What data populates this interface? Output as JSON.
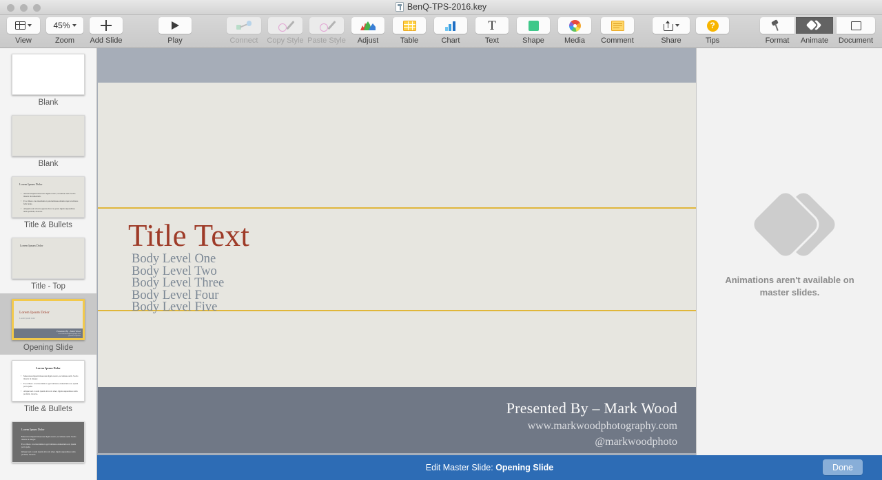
{
  "window": {
    "title": "BenQ-TPS-2016.key",
    "file_icon": "keynote-document-icon"
  },
  "toolbar": {
    "left_group": [
      {
        "label": "View",
        "icon": "layout-panels-icon",
        "has_chevron": true,
        "enabled": true
      },
      {
        "label": "Zoom",
        "icon": "zoom-value",
        "value": "45%",
        "has_chevron": true,
        "enabled": true
      },
      {
        "label": "Add Slide",
        "icon": "plus-icon",
        "has_chevron": false,
        "enabled": true
      },
      {
        "label": "Play",
        "icon": "play-triangle-icon",
        "has_chevron": false,
        "enabled": true
      }
    ],
    "center_group": [
      {
        "label": "Connect",
        "icon": "connect-icon",
        "enabled": false
      },
      {
        "label": "Copy Style",
        "icon": "eyedropper-icon",
        "enabled": false
      },
      {
        "label": "Paste Style",
        "icon": "eyedropper-icon",
        "enabled": false
      },
      {
        "label": "Adjust",
        "icon": "histogram-icon",
        "enabled": true
      },
      {
        "label": "Table",
        "icon": "table-grid-icon",
        "enabled": true
      },
      {
        "label": "Chart",
        "icon": "bar-chart-icon",
        "enabled": true
      },
      {
        "label": "Text",
        "icon": "text-t-icon",
        "enabled": true
      },
      {
        "label": "Shape",
        "icon": "square-shape-icon",
        "enabled": true
      },
      {
        "label": "Media",
        "icon": "photos-color-wheel-icon",
        "enabled": true
      },
      {
        "label": "Comment",
        "icon": "sticky-note-icon",
        "enabled": true
      }
    ],
    "share_group": [
      {
        "label": "Share",
        "icon": "share-upload-icon",
        "has_chevron": true,
        "enabled": true
      },
      {
        "label": "Tips",
        "icon": "question-mark-icon",
        "enabled": true
      }
    ],
    "right_group": [
      {
        "label": "Format",
        "icon": "paintbrush-icon",
        "selected": false
      },
      {
        "label": "Animate",
        "icon": "animate-diamonds-icon",
        "selected": true
      },
      {
        "label": "Document",
        "icon": "document-rectangle-icon",
        "selected": false
      }
    ]
  },
  "sidebar": {
    "slides": [
      {
        "name": "Blank",
        "kind": "blank-white",
        "selected": false
      },
      {
        "name": "Blank",
        "kind": "blank-cream",
        "selected": false
      },
      {
        "name": "Title & Bullets",
        "kind": "title-bullets-cream",
        "selected": false,
        "title": "Lorem Ipsum Dolor",
        "bullets": [
          "Aenean aliquam maecenas ligula nostra, accumsan sem. Sociis mauris incrementum.",
          "Et ac libero cras interdum at quis habitasse ullamcorper ut ultrices felis ludus.",
          "Aliquam sem viverra egestas dolor ut, justo ligula suspendisse nulla pretium, rhoncus."
        ]
      },
      {
        "name": "Title - Top",
        "kind": "title-top-cream",
        "selected": false,
        "title": "Lorem Ipsum Dolor"
      },
      {
        "name": "Opening Slide",
        "kind": "opening-slide",
        "selected": true,
        "title": "Lorem Ipsum Dolor",
        "subtitle": "Lorem ipsum dolor",
        "footer_main": "Presented By - Mark Wood",
        "footer_sub1": "www.markwoodphotography.com",
        "footer_sub2": "@markwoodphoto"
      },
      {
        "name": "Title & Bullets",
        "kind": "title-bullets-white",
        "selected": false,
        "title": "Lorem Ipsum Dolor",
        "bullets": [
          "Maecenas aliquam maecenas ligula nostra, accumsan earth. Sociis mauris in integer.",
          "Et ex libero cras interdum at eget habitasse elementum sed, ipsum porta pede.",
          "Aliquet sed. Lorem ipsum dolor sit amet, ligula suspendisse nulla pretium, rhoncus."
        ]
      },
      {
        "name": "",
        "kind": "dark-bullets",
        "selected": false,
        "title": "Lorem Ipsum Dolor",
        "bullets": [
          "Maecenas aliquam maecenas ligula nostra, accumsan earth. Sociis mauris in integer.",
          "Et ex libero cras interdum at eget habitasse elementum sed, ipsum porta pede.",
          "Aliquet sed. Lorem ipsum dolor sit amet, ligula suspendisse nulla pretium, rhoncus."
        ]
      }
    ]
  },
  "slide": {
    "title": "Title Text",
    "body_levels": [
      "Body Level One",
      "Body Level Two",
      "Body Level Three",
      "Body Level Four",
      "Body Level Five"
    ],
    "footer_main": "Presented By – Mark Wood",
    "footer_url": "www.markwoodphotography.com",
    "footer_handle": "@markwoodphoto",
    "colors": {
      "title": "#9e3b28",
      "body": "#7b8794",
      "rule": "#e0b63a",
      "slide_bg": "#e7e6e0",
      "footer_band": "#707886",
      "canvas_bg": "#a6adb8"
    }
  },
  "inspector": {
    "icon": "animate-diamonds-large-icon",
    "message_line1": "Animations aren't available on",
    "message_line2": "master slides."
  },
  "master_bar": {
    "prefix": "Edit Master Slide: ",
    "name": "Opening Slide",
    "done_label": "Done",
    "bar_color": "#2d6cb5"
  }
}
